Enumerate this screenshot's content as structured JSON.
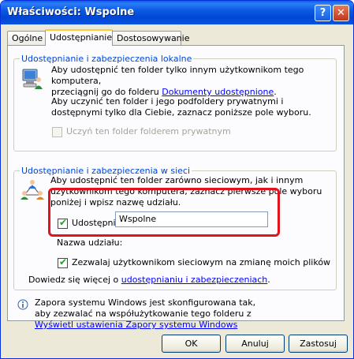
{
  "window": {
    "title": "Właściwości: Wspolne",
    "help_label": "?",
    "close_label": "✕"
  },
  "tabs": [
    {
      "label": "Ogólne"
    },
    {
      "label": "Udostępnianie"
    },
    {
      "label": "Dostosowywanie"
    }
  ],
  "local_group": {
    "title": "Udostępnianie i zabezpieczenia lokalne",
    "text1": "Aby udostępnić ten folder tylko innym użytkownikom tego komputera,",
    "text2": "przeciągnij go do folderu",
    "link": "Dokumenty udostępnione",
    "text2_end": ".",
    "text3": "Aby uczynić ten folder i jego podfoldery prywatnymi i dostępnymi tylko dla Ciebie, zaznacz poniższe pole wyboru.",
    "private_checkbox_label": "Uczyń ten folder folderem prywatnym"
  },
  "network_group": {
    "title": "Udostępnianie i zabezpieczenia w sieci",
    "text": "Aby udostępnić ten folder zarówno sieciowym, jak i innym użytkownikom tego komputera, zaznacz pierwsze pole wyboru poniżej i wpisz nazwę udziału.",
    "share_checkbox_label": "Udostępnij ten folder w sieci",
    "share_name_label": "Nazwa udziału:",
    "share_name_value": "Wspolne",
    "allow_change_label": "Zezwalaj użytkownikom sieciowym na zmianę moich plików"
  },
  "learn_more": {
    "prefix": "Dowiedz się więcej o",
    "link": "udostępnianiu i zabezpieczeniach",
    "suffix": "."
  },
  "firewall": {
    "text": "Zapora systemu Windows jest skonfigurowana tak, aby zezwalać na współużytkowanie tego folderu z innymi komputerami w sieci.",
    "link": "Wyświetl ustawienia Zapory systemu Windows"
  },
  "buttons": {
    "ok": "OK",
    "cancel": "Anuluj",
    "apply": "Zastosuj"
  }
}
